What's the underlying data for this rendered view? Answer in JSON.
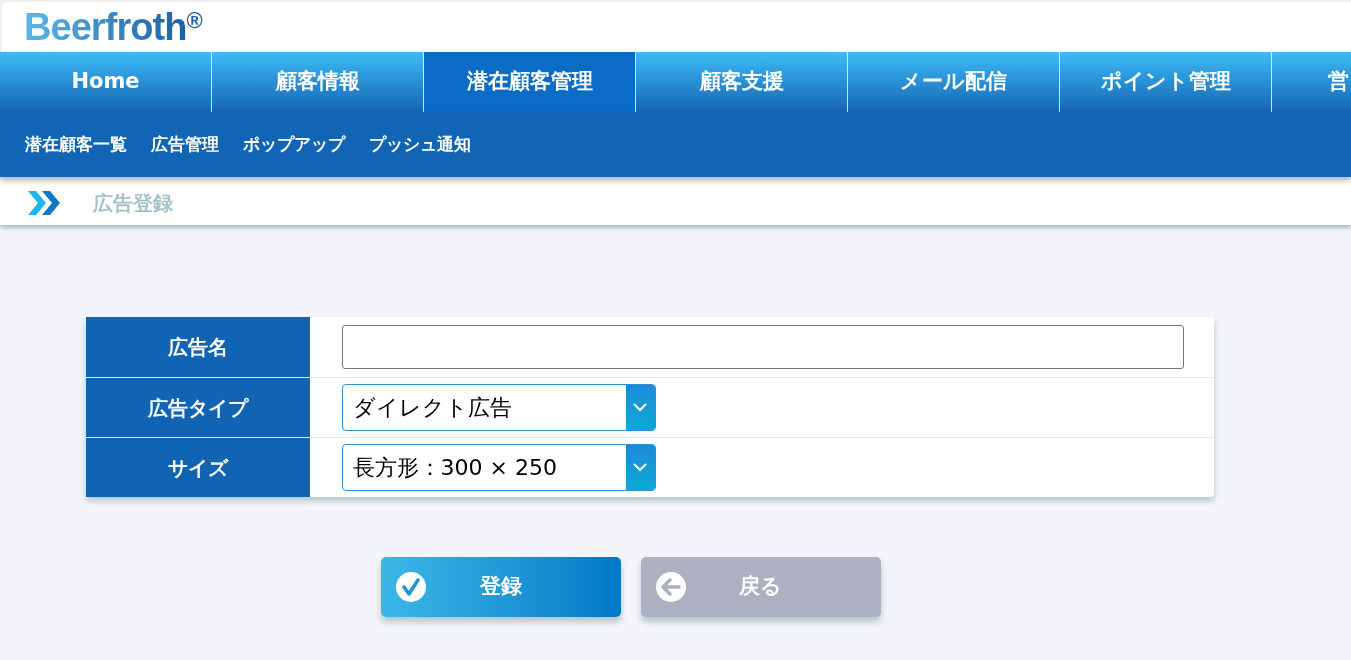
{
  "header": {
    "logo": "Beerfroth",
    "logo_mark": "®"
  },
  "nav": [
    {
      "label": "Home",
      "selected": false
    },
    {
      "label": "顧客情報",
      "selected": false
    },
    {
      "label": "潜在顧客管理",
      "selected": true
    },
    {
      "label": "顧客支援",
      "selected": false
    },
    {
      "label": "メール配信",
      "selected": false
    },
    {
      "label": "ポイント管理",
      "selected": false
    },
    {
      "label": "営",
      "selected": false
    }
  ],
  "subnav": [
    "潜在顧客一覧",
    "広告管理",
    "ポップアップ",
    "プッシュ通知"
  ],
  "breadcrumb": "広告登録",
  "form": {
    "rows": [
      {
        "kind": "text",
        "label": "広告名"
      },
      {
        "kind": "select",
        "label": "広告タイプ",
        "value": "ダイレクト広告"
      },
      {
        "kind": "select",
        "label": "サイズ",
        "value": "長方形：300 × 250"
      }
    ]
  },
  "buttons": [
    {
      "kind": "submit",
      "label": "登録"
    },
    {
      "kind": "back",
      "label": "戻る"
    }
  ]
}
